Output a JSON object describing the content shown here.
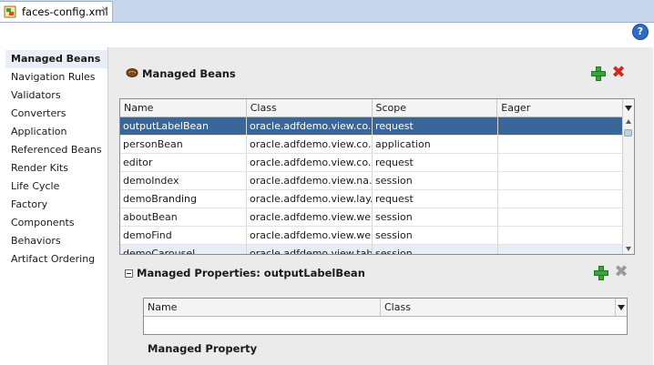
{
  "editor": {
    "tab_title": "faces-config.xml",
    "tab_close_glyph": "×",
    "help_glyph": "?"
  },
  "nav": {
    "items": [
      {
        "label": "Managed Beans",
        "active": true
      },
      {
        "label": "Navigation Rules"
      },
      {
        "label": "Validators"
      },
      {
        "label": "Converters"
      },
      {
        "label": "Application"
      },
      {
        "label": "Referenced Beans"
      },
      {
        "label": "Render Kits"
      },
      {
        "label": "Life Cycle"
      },
      {
        "label": "Factory"
      },
      {
        "label": "Components"
      },
      {
        "label": "Behaviors"
      },
      {
        "label": "Artifact Ordering"
      }
    ]
  },
  "beans": {
    "title": "Managed Beans",
    "columns": [
      "Name",
      "Class",
      "Scope",
      "Eager"
    ],
    "rows": [
      {
        "name": "outputLabelBean",
        "class": "oracle.adfdemo.view.co...",
        "scope": "request",
        "eager": ""
      },
      {
        "name": "personBean",
        "class": "oracle.adfdemo.view.co...",
        "scope": "application",
        "eager": ""
      },
      {
        "name": "editor",
        "class": "oracle.adfdemo.view.co...",
        "scope": "request",
        "eager": ""
      },
      {
        "name": "demoIndex",
        "class": "oracle.adfdemo.view.na...",
        "scope": "session",
        "eager": ""
      },
      {
        "name": "demoBranding",
        "class": "oracle.adfdemo.view.lay...",
        "scope": "request",
        "eager": ""
      },
      {
        "name": "aboutBean",
        "class": "oracle.adfdemo.view.we...",
        "scope": "session",
        "eager": ""
      },
      {
        "name": "demoFind",
        "class": "oracle.adfdemo.view.we...",
        "scope": "session",
        "eager": ""
      },
      {
        "name": "demoCarousel",
        "class": "oracle.adfdemo.view.tab...",
        "scope": "session",
        "eager": ""
      }
    ]
  },
  "properties": {
    "title": "Managed Properties: outputLabelBean",
    "columns": [
      "Name",
      "Class"
    ],
    "subsection_title": "Managed Property"
  },
  "colors": {
    "selection": "#39679a",
    "add_green": "#3ba33b",
    "delete_red": "#d4261f"
  }
}
